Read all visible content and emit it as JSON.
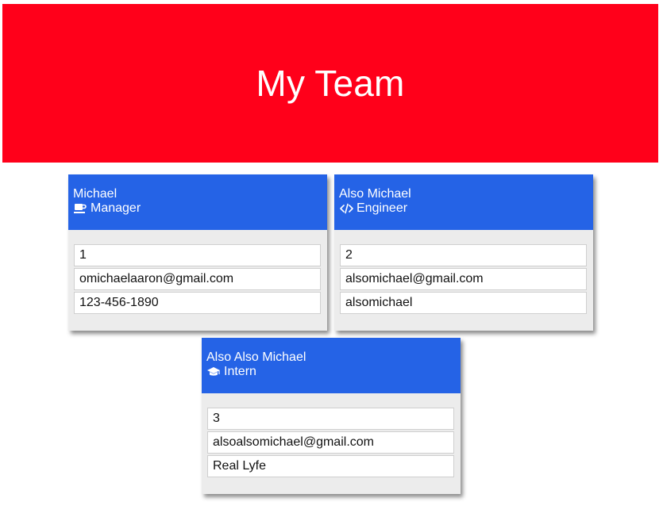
{
  "header": {
    "title": "My Team",
    "background_color": "#ff001a"
  },
  "accent_color": "#2563e6",
  "team": [
    {
      "name": "Michael",
      "role": "Manager",
      "role_icon": "coffee-mug-icon",
      "id": "1",
      "email": "omichaelaaron@gmail.com",
      "detail": "123-456-1890"
    },
    {
      "name": "Also Michael",
      "role": "Engineer",
      "role_icon": "code-brackets-icon",
      "id": "2",
      "email": "alsomichael@gmail.com",
      "detail": "alsomichael"
    },
    {
      "name": "Also Also Michael",
      "role": "Intern",
      "role_icon": "graduation-cap-icon",
      "id": "3",
      "email": "alsoalsomichael@gmail.com",
      "detail": "Real Lyfe"
    }
  ]
}
